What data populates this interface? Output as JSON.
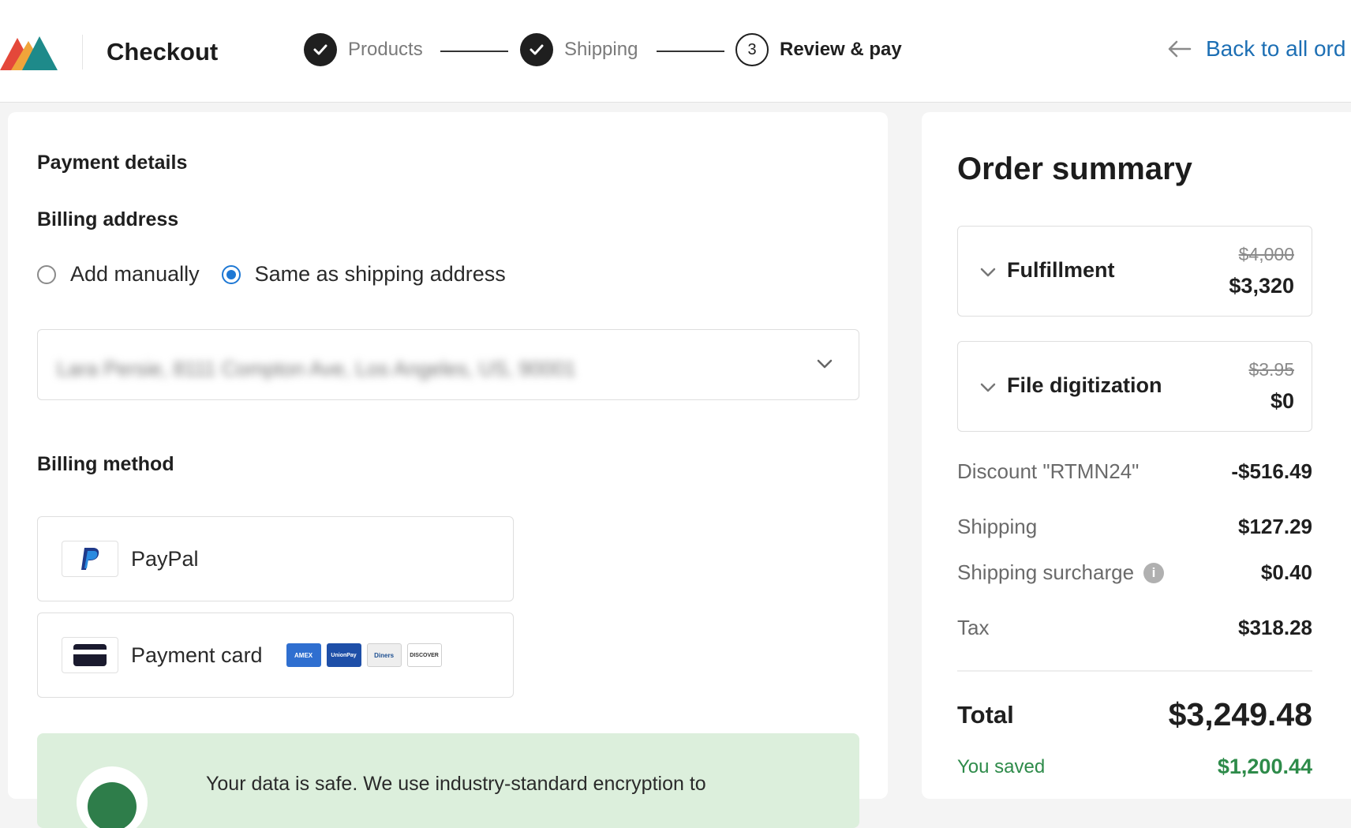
{
  "header": {
    "title": "Checkout",
    "steps": [
      {
        "label": "Products",
        "state": "done"
      },
      {
        "label": "Shipping",
        "state": "done"
      },
      {
        "label": "Review & pay",
        "state": "current",
        "number": "3"
      }
    ],
    "back_label": "Back to all ord"
  },
  "payment": {
    "section_title": "Payment details",
    "billing_address_title": "Billing address",
    "options": {
      "manual": "Add manually",
      "same": "Same as shipping address"
    },
    "selected_option": "same",
    "address_value": "Lara Persie, 8111 Compton Ave, Los Angeles, US, 90001",
    "billing_method_title": "Billing method",
    "methods": {
      "paypal": "PayPal",
      "card": "Payment card"
    },
    "card_logos": [
      {
        "name": "amex-logo",
        "text": "AMEX",
        "bg": "#2f6fd0",
        "fg": "#ffffff"
      },
      {
        "name": "unionpay-logo",
        "text": "UnionPay",
        "bg": "#1e4fa8",
        "fg": "#ffffff"
      },
      {
        "name": "diners-logo",
        "text": "Diners",
        "bg": "#eeeeee",
        "fg": "#1d4f91"
      },
      {
        "name": "discover-logo",
        "text": "DISCOVER",
        "bg": "#ffffff",
        "fg": "#333333"
      }
    ],
    "safe_text": "Your data is safe. We use industry-standard encryption to"
  },
  "summary": {
    "title": "Order summary",
    "items": [
      {
        "label": "Fulfillment",
        "old_price": "$4,000",
        "price": "$3,320"
      },
      {
        "label": "File digitization",
        "old_price": "$3.95",
        "price": "$0"
      }
    ],
    "lines": [
      {
        "label": "Discount \"RTMN24\"",
        "value": "-$516.49"
      },
      {
        "label": "Shipping",
        "value": "$127.29"
      },
      {
        "label": "Shipping surcharge",
        "value": "$0.40"
      },
      {
        "label": "Tax",
        "value": "$318.28"
      }
    ],
    "info_glyph": "i",
    "total_label": "Total",
    "total_value": "$3,249.48",
    "saved_label": "You saved",
    "saved_value": "$1,200.44"
  },
  "colors": {
    "accent": "#1e78d4",
    "link": "#1d6fb4",
    "success": "#2e8b4a",
    "safe_bg": "#dcefdc",
    "logo": [
      "#e4483a",
      "#f0a43a",
      "#1e8a8a"
    ]
  }
}
